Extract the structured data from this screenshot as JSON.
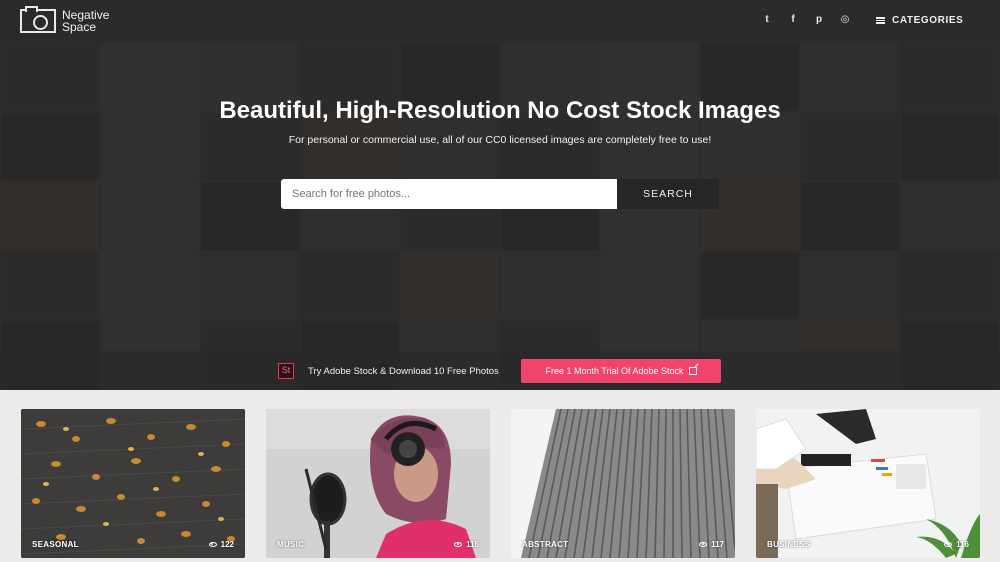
{
  "header": {
    "logo_text_line1": "Negative",
    "logo_text_line2": "Space",
    "social": [
      {
        "icon": "twitter-icon",
        "glyph": "t"
      },
      {
        "icon": "facebook-icon",
        "glyph": "f"
      },
      {
        "icon": "pinterest-icon",
        "glyph": "p"
      },
      {
        "icon": "instagram-icon",
        "glyph": "◎"
      }
    ],
    "categories_label": "CATEGORIES"
  },
  "hero": {
    "title": "Beautiful, High-Resolution No Cost Stock Images",
    "subtitle": "For personal or commercial use, all of our CC0 licensed images are completely free to use!",
    "search": {
      "placeholder": "Search for free photos...",
      "value": "",
      "button_label": "SEARCH"
    }
  },
  "promo": {
    "badge": "St",
    "text": "Try Adobe Stock & Download 10 Free Photos",
    "button_label": "Free 1 Month Trial Of Adobe Stock"
  },
  "cards": [
    {
      "label": "SEASONAL",
      "views": "122"
    },
    {
      "label": "MUSIC",
      "views": "116"
    },
    {
      "label": "ABSTRACT",
      "views": "117"
    },
    {
      "label": "BUSINESS",
      "views": "116"
    }
  ],
  "colors": {
    "header_bg": "#2b2b2b",
    "accent_pink": "#f2436a",
    "search_button": "#262626",
    "page_bg": "#ecebe9"
  }
}
